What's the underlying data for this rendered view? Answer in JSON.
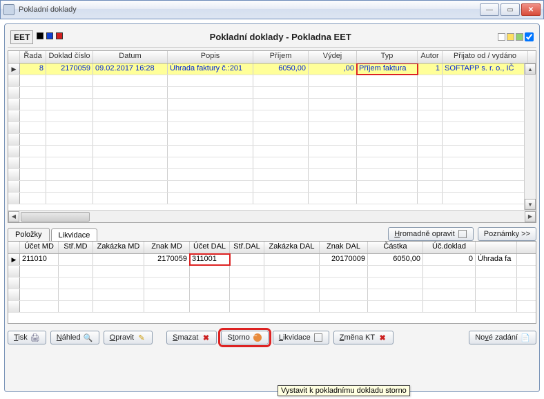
{
  "window": {
    "title": "Pokladní doklady"
  },
  "header": {
    "eet": "EET",
    "title": "Pokladní doklady - Pokladna EET"
  },
  "main_grid": {
    "columns": [
      "Řada",
      "Doklad číslo",
      "Datum",
      "Popis",
      "Příjem",
      "Výdej",
      "Typ",
      "Autor",
      "Přijato od / vydáno"
    ],
    "rows": [
      {
        "rada": "8",
        "doklad": "2170059",
        "datum": "09.02.2017 16:28",
        "popis": "Úhrada faktury č.:201",
        "prijem": "6050,00",
        "vydej": ",00",
        "typ": "Příjem faktura",
        "autor": "1",
        "prijato": "SOFTAPP s. r. o., IČ"
      }
    ]
  },
  "tabs": {
    "polozky": "Položky",
    "likvidace": "Likvidace"
  },
  "tab_buttons": {
    "hromadne": "Hromadně opravit",
    "poznamky": "Poznámky >>"
  },
  "sub_grid": {
    "columns": [
      "Účet MD",
      "Stř.MD",
      "Zakázka MD",
      "Znak MD",
      "Účet DAL",
      "Stř.DAL",
      "Zakázka DAL",
      "Znak DAL",
      "Částka",
      "Úč.doklad",
      ""
    ],
    "rows": [
      {
        "ucetmd": "211010",
        "strmd": "",
        "zakmd": "",
        "znakmd": "2170059",
        "ucetdal": "311001",
        "strdal": "",
        "zakdal": "",
        "znakdal": "20170009",
        "castka": "6050,00",
        "ucdok": "0",
        "tail": "Úhrada fa"
      }
    ]
  },
  "buttons": {
    "tisk": "Tisk",
    "nahled": "Náhled",
    "opravit": "Opravit",
    "smazat": "Smazat",
    "storno": "Storno",
    "likvidace": "Likvidace",
    "zmenakt": "Změna KT",
    "novezadani": "Nové zadání"
  },
  "tooltip": "Vystavit k pokladnímu dokladu storno"
}
